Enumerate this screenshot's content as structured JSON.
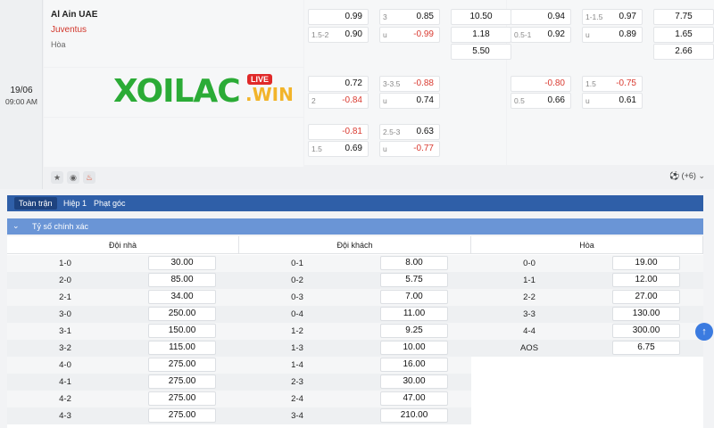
{
  "match": {
    "date": "19/06",
    "time": "09:00 AM",
    "home": "Al Ain UAE",
    "away": "Juventus",
    "draw": "Hòa",
    "logo": {
      "main": "XOILAC",
      "live": "LIVE",
      "suffix": ".WIN"
    },
    "more_count": "(+6)"
  },
  "odds_groups": [
    {
      "rows": [
        [
          {
            "l": "",
            "v": "0.99"
          },
          {
            "l": "3",
            "v": "0.85"
          },
          {
            "l": "",
            "v": "10.50"
          }
        ],
        [
          {
            "l": "1.5-2",
            "v": "0.90"
          },
          {
            "l": "u",
            "v": "-0.99"
          },
          {
            "l": "",
            "v": "1.18"
          }
        ],
        [
          null,
          null,
          {
            "l": "",
            "v": "5.50"
          }
        ]
      ]
    },
    {
      "rows": [
        [
          {
            "l": "",
            "v": "0.94"
          },
          {
            "l": "1-1.5",
            "v": "0.97"
          },
          {
            "l": "",
            "v": "7.75"
          }
        ],
        [
          {
            "l": "0.5-1",
            "v": "0.92"
          },
          {
            "l": "u",
            "v": "0.89"
          },
          {
            "l": "",
            "v": "1.65"
          }
        ],
        [
          null,
          null,
          {
            "l": "",
            "v": "2.66"
          }
        ]
      ]
    }
  ],
  "odds_row2": [
    [
      {
        "l": "",
        "v": "0.72"
      },
      {
        "l": "3-3.5",
        "v": "-0.88"
      }
    ],
    [
      {
        "l": "2",
        "v": "-0.84"
      },
      {
        "l": "u",
        "v": "0.74"
      }
    ]
  ],
  "odds_row2b": [
    [
      {
        "l": "",
        "v": "-0.80"
      },
      {
        "l": "1.5",
        "v": "-0.75"
      }
    ],
    [
      {
        "l": "0.5",
        "v": "0.66"
      },
      {
        "l": "u",
        "v": "0.61"
      }
    ]
  ],
  "odds_row3": [
    [
      {
        "l": "",
        "v": "-0.81"
      },
      {
        "l": "2.5-3",
        "v": "0.63"
      }
    ],
    [
      {
        "l": "1.5",
        "v": "0.69"
      },
      {
        "l": "u",
        "v": "-0.77"
      }
    ]
  ],
  "tabs": [
    "Toàn trận",
    "Hiệp 1",
    "Phạt góc"
  ],
  "section_title": "Tỷ số chính xác",
  "columns": [
    {
      "header": "Đội nhà",
      "rows": [
        {
          "score": "1-0",
          "odd": "30.00"
        },
        {
          "score": "2-0",
          "odd": "85.00"
        },
        {
          "score": "2-1",
          "odd": "34.00"
        },
        {
          "score": "3-0",
          "odd": "250.00"
        },
        {
          "score": "3-1",
          "odd": "150.00"
        },
        {
          "score": "3-2",
          "odd": "115.00"
        },
        {
          "score": "4-0",
          "odd": "275.00"
        },
        {
          "score": "4-1",
          "odd": "275.00"
        },
        {
          "score": "4-2",
          "odd": "275.00"
        },
        {
          "score": "4-3",
          "odd": "275.00"
        }
      ]
    },
    {
      "header": "Đội khách",
      "rows": [
        {
          "score": "0-1",
          "odd": "8.00"
        },
        {
          "score": "0-2",
          "odd": "5.75"
        },
        {
          "score": "0-3",
          "odd": "7.00"
        },
        {
          "score": "0-4",
          "odd": "11.00"
        },
        {
          "score": "1-2",
          "odd": "9.25"
        },
        {
          "score": "1-3",
          "odd": "10.00"
        },
        {
          "score": "1-4",
          "odd": "16.00"
        },
        {
          "score": "2-3",
          "odd": "30.00"
        },
        {
          "score": "2-4",
          "odd": "47.00"
        },
        {
          "score": "3-4",
          "odd": "210.00"
        }
      ]
    },
    {
      "header": "Hòa",
      "rows": [
        {
          "score": "0-0",
          "odd": "19.00"
        },
        {
          "score": "1-1",
          "odd": "12.00"
        },
        {
          "score": "2-2",
          "odd": "27.00"
        },
        {
          "score": "3-3",
          "odd": "130.00"
        },
        {
          "score": "4-4",
          "odd": "300.00"
        },
        {
          "score": "AOS",
          "odd": "6.75"
        }
      ]
    }
  ],
  "colors": {
    "tab_bg": "#2f5fa8",
    "section_bg": "#6a95d6",
    "negative": "#d93a30",
    "accent_team": "#d2362b"
  }
}
